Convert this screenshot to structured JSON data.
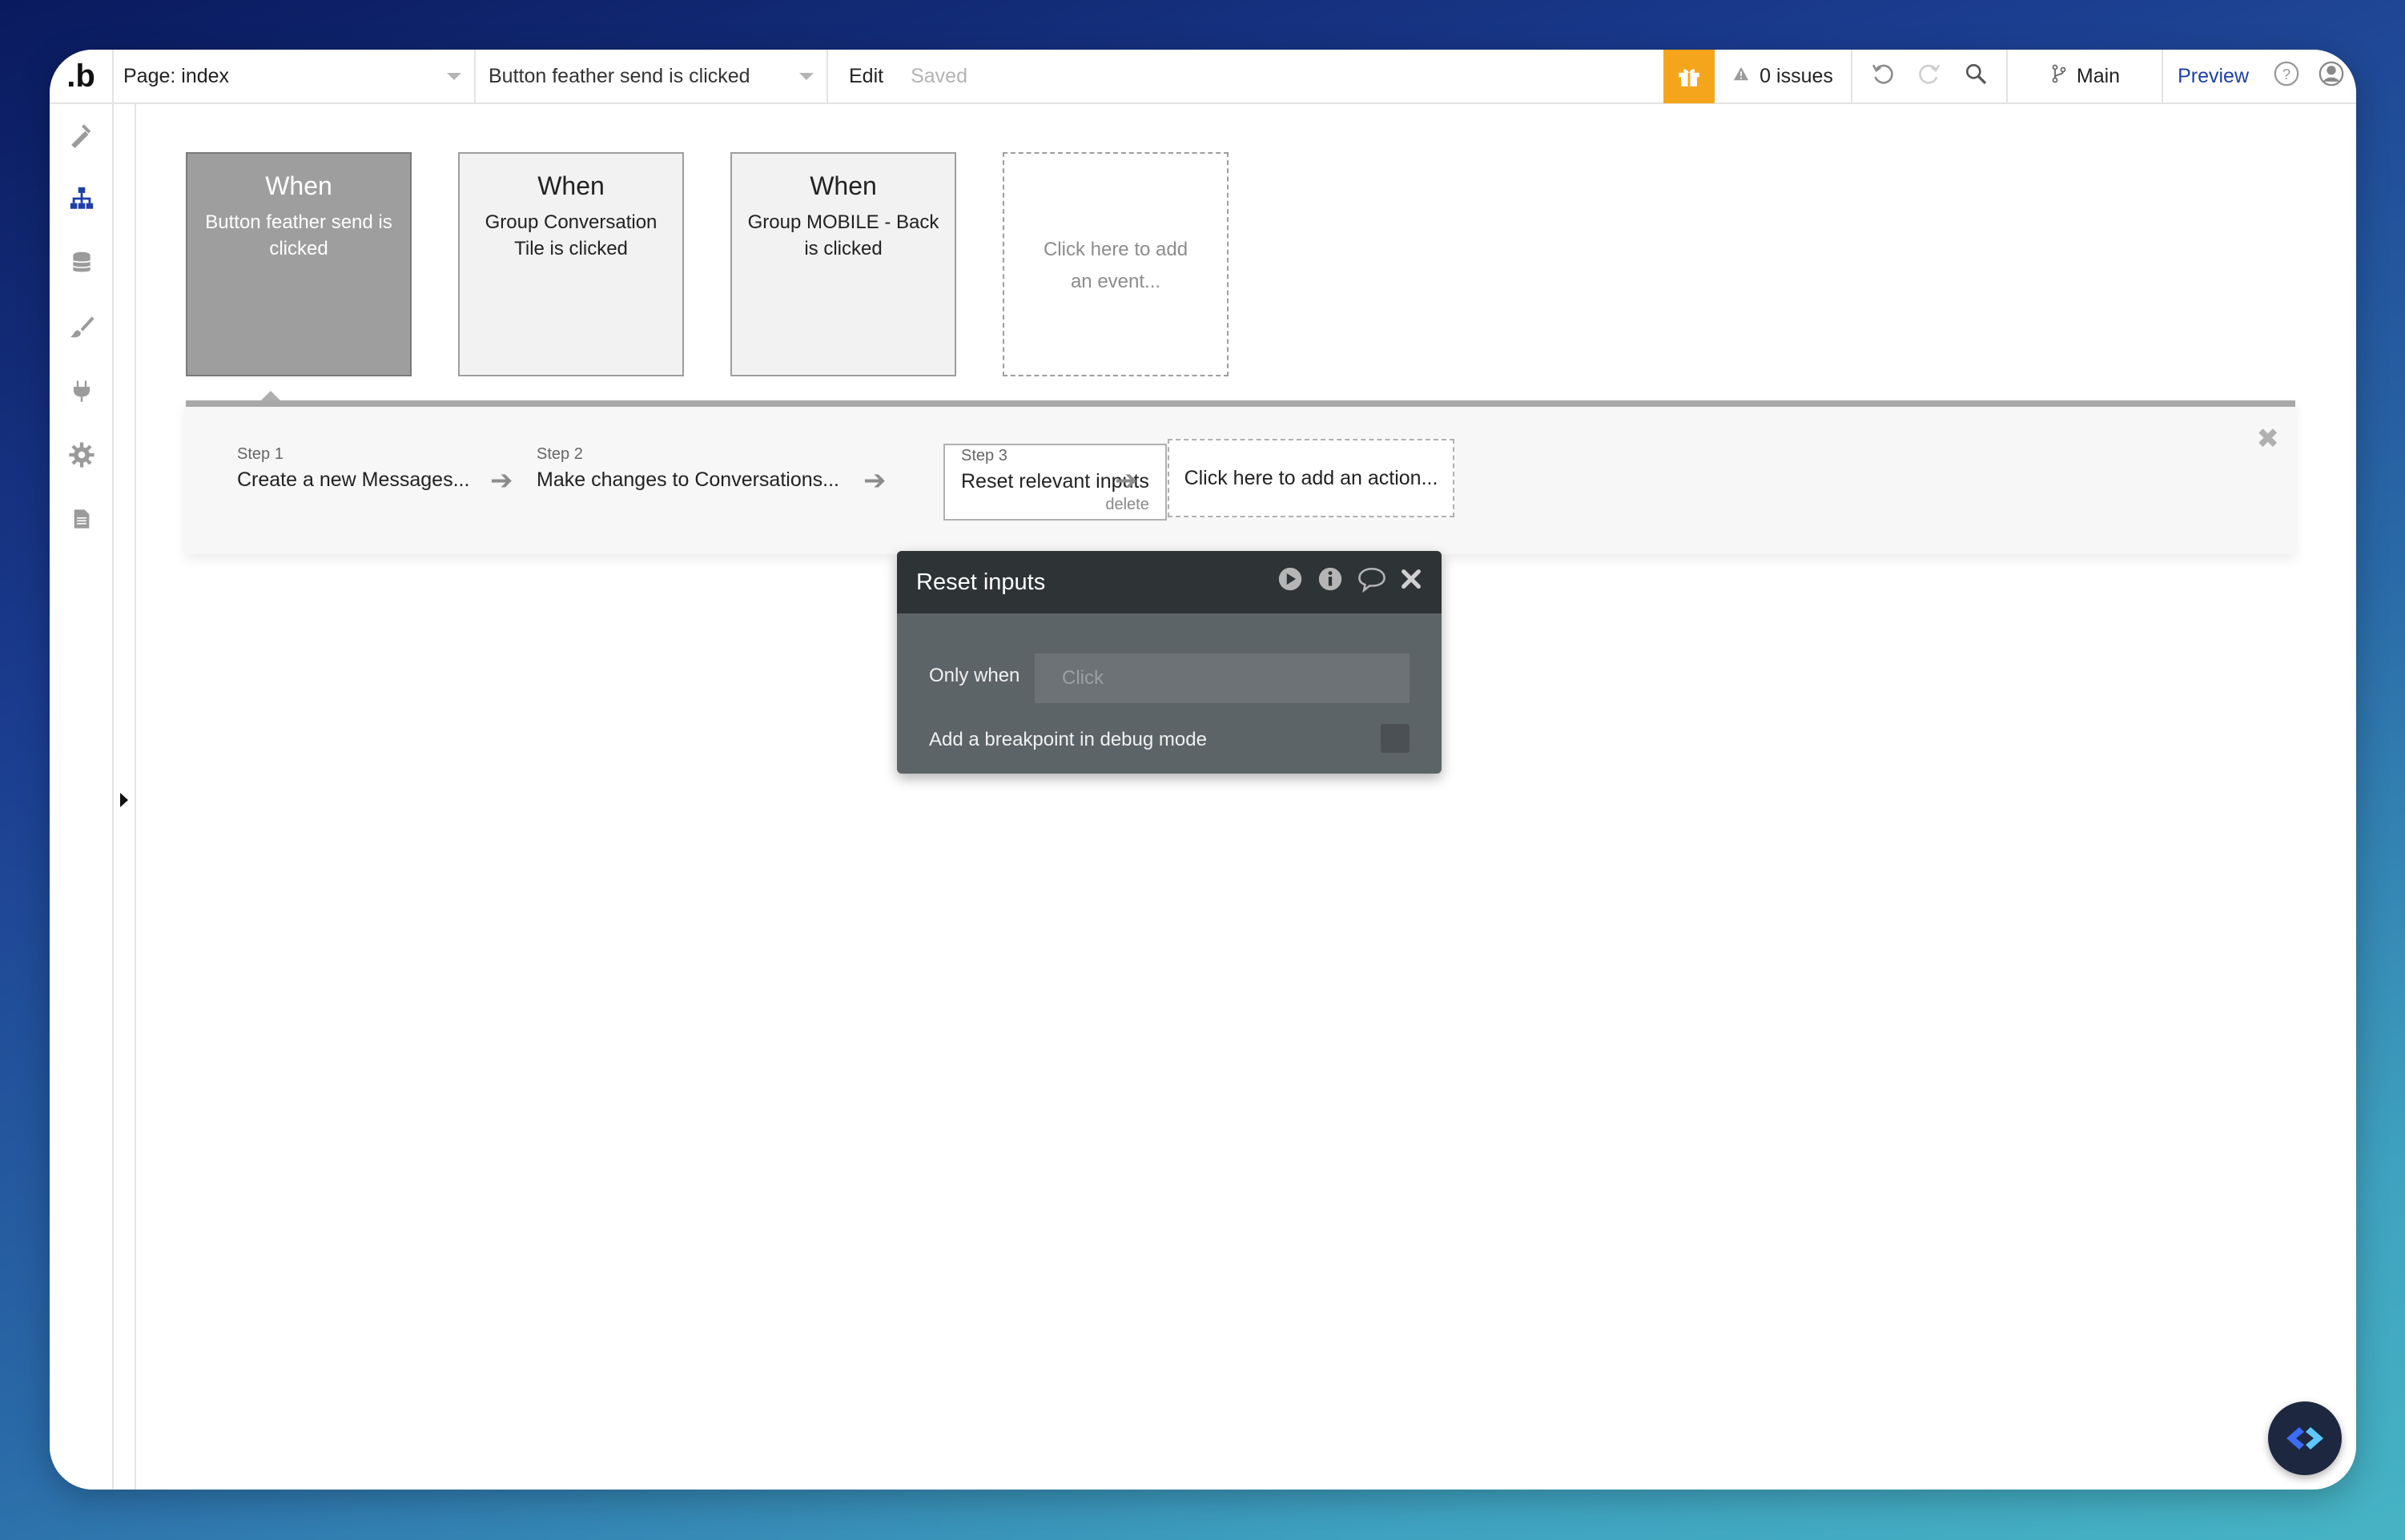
{
  "topbar": {
    "logo": ".b",
    "page_selector": "Page: index",
    "event_selector": "Button feather send is clicked",
    "edit": "Edit",
    "saved": "Saved",
    "issues": "0 issues",
    "branch": "Main",
    "preview": "Preview"
  },
  "events": [
    {
      "when": "When",
      "desc": "Button feather send is clicked"
    },
    {
      "when": "When",
      "desc": "Group Conversation Tile is clicked"
    },
    {
      "when": "When",
      "desc": "Group MOBILE - Back is clicked"
    }
  ],
  "add_event": "Click here to add an event...",
  "steps": [
    {
      "num": "Step 1",
      "title": "Create a new Messages..."
    },
    {
      "num": "Step 2",
      "title": "Make changes to Conversations..."
    },
    {
      "num": "Step 3",
      "title": "Reset relevant inputs",
      "delete": "delete"
    }
  ],
  "add_action": "Click here to add an action...",
  "popup": {
    "title": "Reset inputs",
    "only_when_label": "Only when",
    "only_when_placeholder": "Click",
    "breakpoint_label": "Add a breakpoint in debug mode"
  },
  "colors": {
    "accent": "#1e3fa8",
    "gift": "#f5a51c",
    "active_event": "#9e9e9e",
    "popup_header": "#2e3335",
    "popup_body": "#5d6467"
  },
  "icons": {
    "sidebar": [
      "design-icon",
      "workflow-icon",
      "data-icon",
      "styles-icon",
      "plugins-icon",
      "settings-icon",
      "logs-icon"
    ],
    "topbar": [
      "gift-icon",
      "warning-icon",
      "undo-icon",
      "redo-icon",
      "search-icon",
      "branch-icon",
      "help-icon",
      "account-icon"
    ],
    "popup": [
      "play-icon",
      "info-icon",
      "comment-icon",
      "close-icon"
    ]
  }
}
